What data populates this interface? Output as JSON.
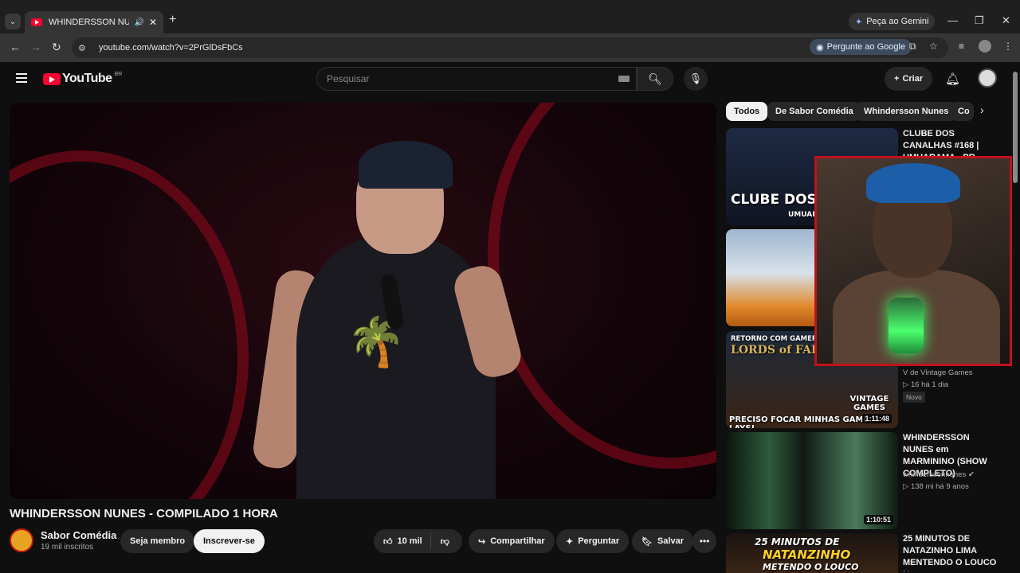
{
  "browser": {
    "tab_title": "WHINDERSSON NUNES - C",
    "gemini_label": "Peça ao Gemini",
    "url": "youtube.com/watch?v=2PrGlDsFbCs",
    "ask_google_label": "Pergunte ao Google"
  },
  "header": {
    "logo_text": "YouTube",
    "region": "BR",
    "search_placeholder": "Pesquisar",
    "create_label": "Criar"
  },
  "video": {
    "title": "WHINDERSSON NUNES - COMPILADO 1 HORA",
    "channel_name": "Sabor Comédia",
    "subscribers": "19 mil inscritos",
    "member_label": "Seja membro",
    "subscribe_label": "Inscrever-se",
    "likes": "10 mil",
    "share_label": "Compartilhar",
    "ask_label": "Perguntar",
    "save_label": "Salvar"
  },
  "chips": [
    "Todos",
    "De Sabor Comédia",
    "Whindersson Nunes",
    "Co"
  ],
  "recommendations": [
    {
      "title": "CLUBE DOS CANALHAS #168 | UMUARAMA - PR",
      "thumb_text": "CLUBE DOS CA",
      "thumb_sub": "UMUARA"
    },
    {
      "title": "",
      "thumb_text": ""
    },
    {
      "title": "",
      "channel": "V de Vintage Games",
      "views": "16",
      "age": "há 1 dia",
      "badge": "Novo",
      "duration": "1:11:48",
      "thumb_top": "RETORNO COM GAMEPL",
      "thumb_mid": "LORDS of FALL",
      "thumb_bottom": "PRECISO FOCAR MINHAS GAME... LAYS!",
      "thumb_brand": "VINTAGE GAMES"
    },
    {
      "title": "WHINDERSSON NUNES em MARMININO (SHOW COMPLETO)",
      "channel": "whinderssonnunes",
      "views": "138 mi",
      "age": "há 9 anos",
      "duration": "1:10:51"
    },
    {
      "title": "25 MINUTOS DE NATAZINHO LIMA MENTENDO O LOUCO N",
      "thumb_line1": "25 MINUTOS DE",
      "thumb_line2": "NATANZINHO",
      "thumb_line3": "METENDO O LOUCO"
    }
  ],
  "colors": {
    "brand_red": "#ff0033",
    "webcam_border": "#c2111c"
  }
}
